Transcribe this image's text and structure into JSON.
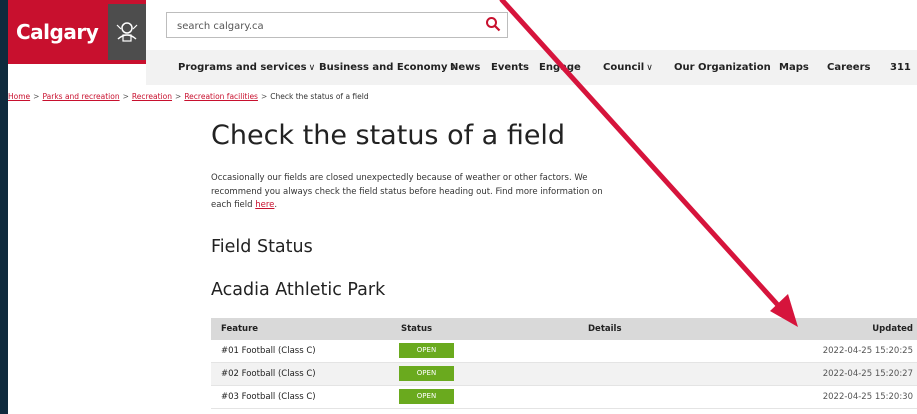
{
  "header": {
    "logo_text": "Calgary",
    "search_placeholder": "search calgary.ca"
  },
  "nav": {
    "items": [
      {
        "label": "Programs and services",
        "chevron": "∨"
      },
      {
        "label": "Business and Economy",
        "chevron": "∨"
      },
      {
        "label": "News",
        "chevron": ""
      },
      {
        "label": "Events",
        "chevron": ""
      },
      {
        "label": "Engage",
        "chevron": ""
      },
      {
        "label": "Council",
        "chevron": "∨"
      },
      {
        "label": "Our Organization",
        "chevron": ""
      },
      {
        "label": "Maps",
        "chevron": ""
      },
      {
        "label": "Careers",
        "chevron": ""
      },
      {
        "label": "311",
        "chevron": ""
      }
    ]
  },
  "breadcrumb": {
    "links": [
      "Home",
      "Parks and recreation",
      "Recreation",
      "Recreation facilities"
    ],
    "separator": ">",
    "current": "Check the status of a field"
  },
  "page": {
    "title": "Check the status of a field",
    "intro": "Occasionally our fields are closed unexpectedly because of weather or other factors. We recommend you always check the field status before heading out. Find more information on each field ",
    "intro_link": "here",
    "intro_end": ".",
    "section_title": "Field Status",
    "park_name": "Acadia Athletic Park"
  },
  "table": {
    "headers": {
      "feature": "Feature",
      "status": "Status",
      "details": "Details",
      "updated": "Updated"
    },
    "rows": [
      {
        "feature": "#01 Football (Class C)",
        "status": "OPEN",
        "details": "",
        "updated": "2022-04-25 15:20:25"
      },
      {
        "feature": "#02 Football (Class C)",
        "status": "OPEN",
        "details": "",
        "updated": "2022-04-25 15:20:27"
      },
      {
        "feature": "#03 Football (Class C)",
        "status": "OPEN",
        "details": "",
        "updated": "2022-04-25 15:20:30"
      }
    ]
  },
  "colors": {
    "brand_red": "#c8102e",
    "status_open": "#6aaa1e",
    "annotation_arrow": "#d6143c",
    "frame": "#0f2a3d"
  },
  "icons": {
    "search": "search-icon",
    "crest": "city-crest-icon"
  }
}
